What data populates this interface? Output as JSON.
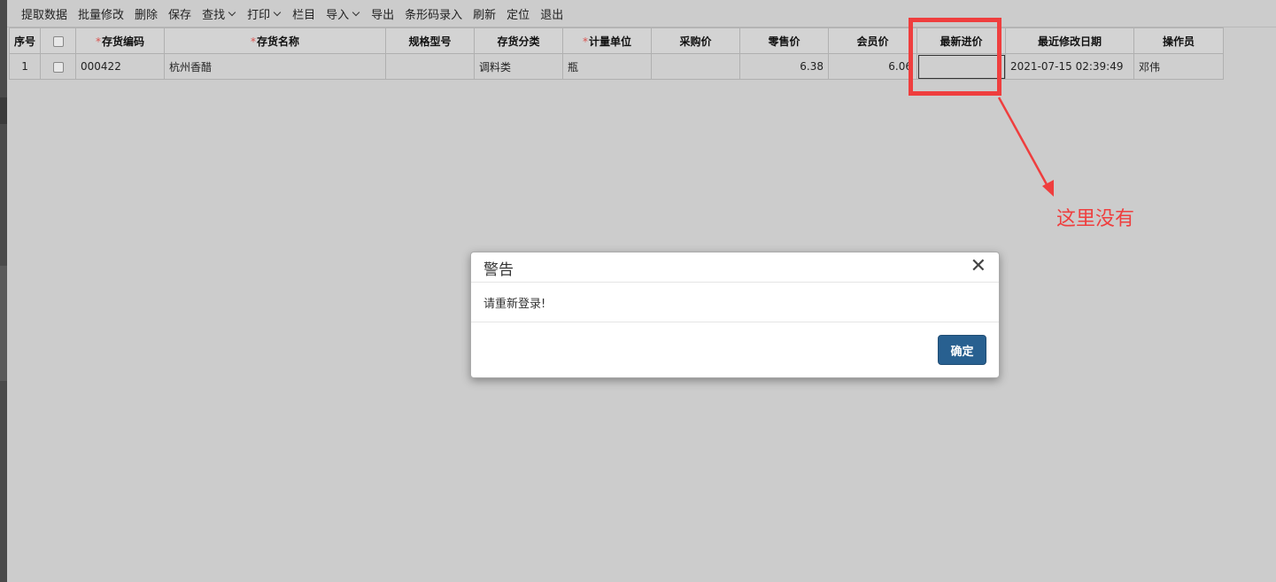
{
  "toolbar": {
    "items": [
      {
        "label": "提取数据",
        "dropdown": false
      },
      {
        "label": "批量修改",
        "dropdown": false
      },
      {
        "label": "删除",
        "dropdown": false
      },
      {
        "label": "保存",
        "dropdown": false
      },
      {
        "label": "查找",
        "dropdown": true
      },
      {
        "label": "打印",
        "dropdown": true
      },
      {
        "label": "栏目",
        "dropdown": false
      },
      {
        "label": "导入",
        "dropdown": true
      },
      {
        "label": "导出",
        "dropdown": false
      },
      {
        "label": "条形码录入",
        "dropdown": false
      },
      {
        "label": "刷新",
        "dropdown": false
      },
      {
        "label": "定位",
        "dropdown": false
      },
      {
        "label": "退出",
        "dropdown": false
      }
    ]
  },
  "table": {
    "columns": [
      {
        "label": "序号",
        "required": false
      },
      {
        "label": "",
        "required": false,
        "checkbox": true
      },
      {
        "label": "存货编码",
        "required": true
      },
      {
        "label": "存货名称",
        "required": true
      },
      {
        "label": "规格型号",
        "required": false
      },
      {
        "label": "存货分类",
        "required": false
      },
      {
        "label": "计量单位",
        "required": true
      },
      {
        "label": "采购价",
        "required": false
      },
      {
        "label": "零售价",
        "required": false
      },
      {
        "label": "会员价",
        "required": false
      },
      {
        "label": "最新进价",
        "required": false
      },
      {
        "label": "最近修改日期",
        "required": false
      },
      {
        "label": "操作员",
        "required": false
      }
    ],
    "rows": [
      {
        "index": "1",
        "code": "000422",
        "name": "杭州香醋",
        "spec": "",
        "category": "调料类",
        "unit": "瓶",
        "purchase_price": "",
        "retail_price": "6.38",
        "member_price": "6.06",
        "latest_cost": "",
        "modified_date": "2021-07-15 02:39:49",
        "operator": "邓伟"
      }
    ]
  },
  "annotation": {
    "text": "这里没有",
    "color": "#ef3e3e"
  },
  "modal": {
    "title": "警告",
    "message": "请重新登录!",
    "ok_label": "确定",
    "close_glyph": "✕"
  }
}
